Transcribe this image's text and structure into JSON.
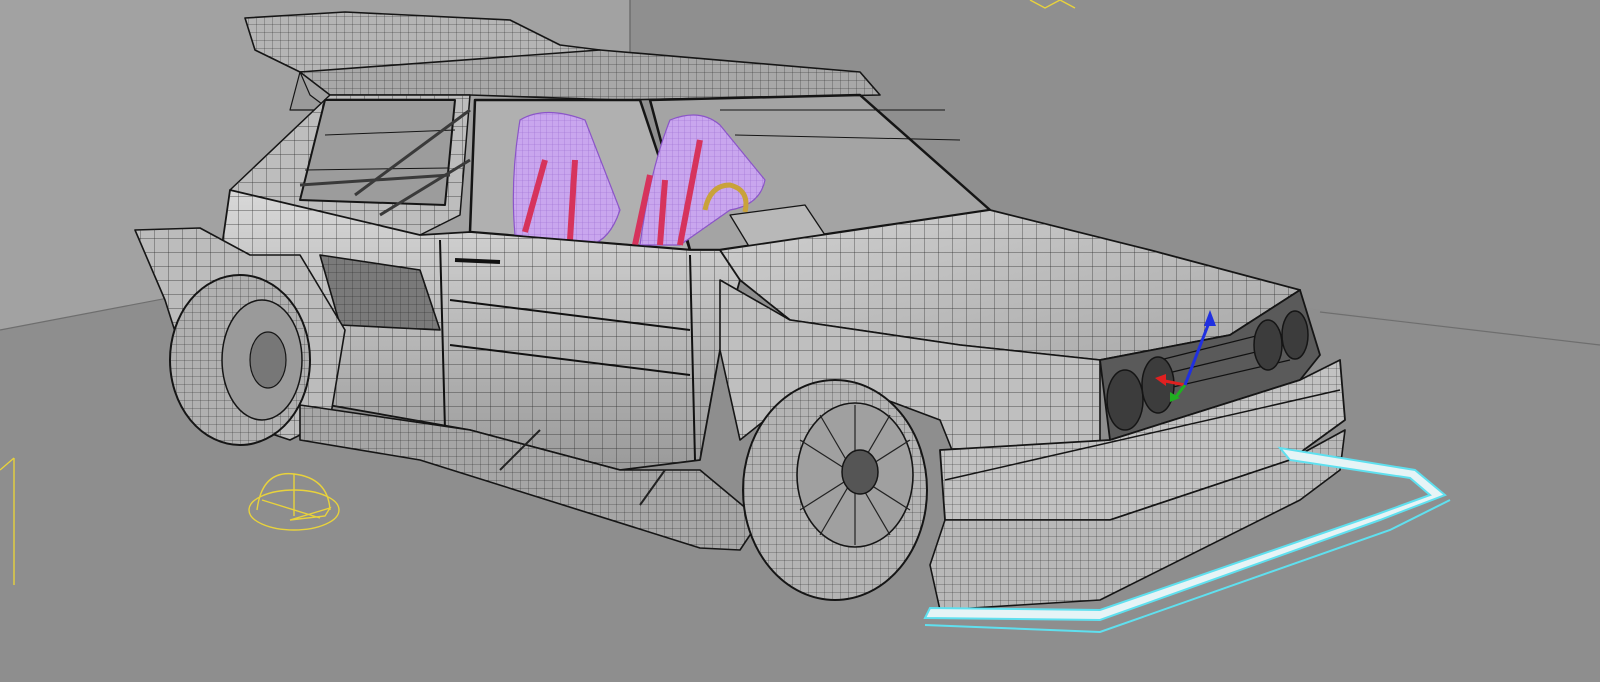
{
  "viewport": {
    "background": "#8a8a8a",
    "wall_color": "#9c9c9c",
    "floor_color": "#8d8d8d",
    "wireframe_color": "#1a1a1a",
    "body_shade": "#c9c9c9",
    "seat_color": "#c9a6ee",
    "harness_color": "#d6335c",
    "selection_color": "#5fe0ef",
    "helper_color": "#e8d23c",
    "gizmo_x_color": "#e02020",
    "gizmo_y_color": "#20b020",
    "gizmo_z_color": "#2030e0"
  },
  "objects": [
    {
      "name": "car-body",
      "icon": "wireframe-mesh"
    },
    {
      "name": "rear-wing",
      "icon": "wireframe-mesh"
    },
    {
      "name": "front-splitter",
      "icon": "selected-mesh"
    },
    {
      "name": "racing-seats",
      "icon": "wireframe-mesh"
    },
    {
      "name": "omni-light-helper",
      "icon": "light-helper-icon"
    },
    {
      "name": "transform-gizmo",
      "icon": "gizmo-icon"
    }
  ]
}
